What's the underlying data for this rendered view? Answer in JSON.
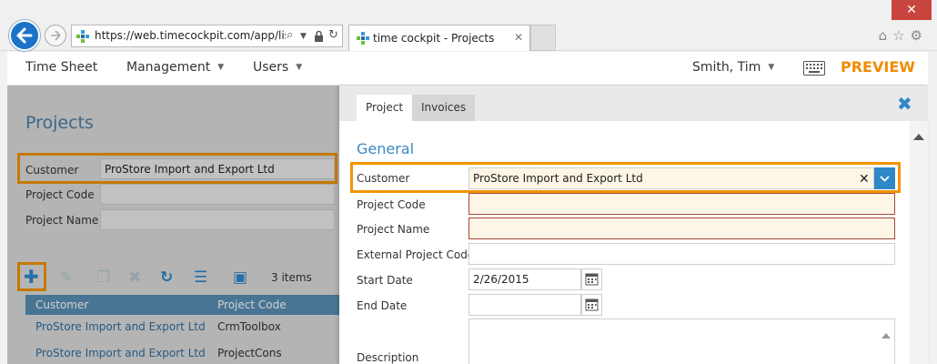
{
  "browser": {
    "close_glyph": "✕",
    "url": "https://web.timecockpit.com/app/lists",
    "tab_title": "time cockpit - Projects",
    "tab_close": "✕"
  },
  "appbar": {
    "menu": [
      "Time Sheet",
      "Management",
      "Users"
    ],
    "user": "Smith, Tim",
    "preview": "PREVIEW",
    "accent": "#f08c00"
  },
  "list_page": {
    "title": "Projects",
    "filters": [
      {
        "label": "Customer",
        "value": "ProStore Import and Export Ltd"
      },
      {
        "label": "Project Code",
        "value": ""
      },
      {
        "label": "Project Name",
        "value": ""
      }
    ],
    "item_count": "3 items",
    "columns": [
      "Customer",
      "Project Code"
    ],
    "rows": [
      {
        "customer": "ProStore Import and Export Ltd",
        "code": "CrmToolbox"
      },
      {
        "customer": "ProStore Import and Export Ltd",
        "code": "ProjectCons"
      }
    ]
  },
  "edit_panel": {
    "tabs": [
      "Project",
      "Invoices"
    ],
    "section": "General",
    "fields": {
      "customer": {
        "label": "Customer",
        "value": "ProStore Import and Export Ltd"
      },
      "project_code": {
        "label": "Project Code",
        "value": ""
      },
      "project_name": {
        "label": "Project Name",
        "value": ""
      },
      "external_code": {
        "label": "External Project Code",
        "value": ""
      },
      "start_date": {
        "label": "Start Date",
        "value": "2/26/2015"
      },
      "end_date": {
        "label": "End Date",
        "value": ""
      },
      "description": {
        "label": "Description",
        "value": ""
      }
    },
    "clear_glyph": "✕",
    "close_glyph": "✖"
  },
  "colors": {
    "highlight": "#f29400",
    "link": "#2f6ea1",
    "primary": "#2f87c8",
    "required_border": "#a54636"
  }
}
